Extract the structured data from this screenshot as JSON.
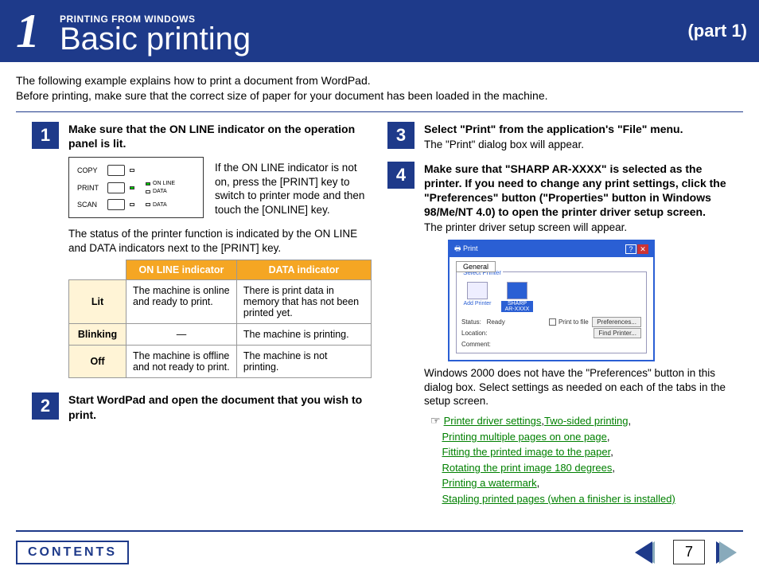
{
  "header": {
    "chapter_num": "1",
    "section": "PRINTING FROM WINDOWS",
    "title": "Basic printing",
    "part": "(part 1)"
  },
  "intro_line1": "The following example explains how to print a document from WordPad.",
  "intro_line2": "Before printing, make sure that the correct size of paper for your document has been loaded in the machine.",
  "steps": {
    "s1": {
      "num": "1",
      "title": "Make sure that the ON LINE indicator on the operation panel is lit."
    },
    "s2": {
      "num": "2",
      "title": "Start WordPad and open the document that you wish to print."
    },
    "s3": {
      "num": "3",
      "title": "Select \"Print\" from the application's \"File\" menu.",
      "text": "The \"Print\" dialog box will appear."
    },
    "s4": {
      "num": "4",
      "title": "Make sure that \"SHARP AR-XXXX\" is selected as the printer. If you need to change any print settings, click the \"Preferences\" button (\"Properties\" button in Windows 98/Me/NT 4.0) to open the printer driver setup screen.",
      "text": "The printer driver setup screen will appear."
    }
  },
  "panel": {
    "copy": "COPY",
    "print": "PRINT",
    "scan": "SCAN",
    "online": "ON LINE",
    "data": "DATA"
  },
  "panel_side_text": "If the ON LINE indicator is not on, press the [PRINT] key to switch to printer mode and then touch the [ONLINE] key.",
  "status_text": "The status of the printer function is indicated by the ON LINE and DATA indicators next to the [PRINT] key.",
  "table": {
    "h1": "ON LINE indicator",
    "h2": "DATA indicator",
    "r1": "Lit",
    "r1c1": "The machine is online and ready to print.",
    "r1c2": "There is print data in memory that has not been printed yet.",
    "r2": "Blinking",
    "r2c1": "—",
    "r2c2": "The machine is printing.",
    "r3": "Off",
    "r3c1": "The machine is offline and not ready to print.",
    "r3c2": "The machine is not printing."
  },
  "dialog": {
    "title": "Print",
    "tab": "General",
    "fieldset": "Select Printer",
    "add_printer": "Add Printer",
    "sharp": "SHARP AR-XXXX",
    "status_lbl": "Status:",
    "status_val": "Ready",
    "location_lbl": "Location:",
    "comment_lbl": "Comment:",
    "print_to_file": "Print to file",
    "preferences": "Preferences...",
    "find_printer": "Find Printer..."
  },
  "after_dialog": "Windows 2000 does not have the \"Preferences\" button in this dialog box. Select settings as needed on each of the tabs in the setup screen.",
  "hand": "☞",
  "links": {
    "l1": "Printer driver settings",
    "l2": "Two-sided printing",
    "l3": "Printing multiple pages on one page",
    "l4": "Fitting the printed image to the paper",
    "l5": "Rotating the print image 180 degrees",
    "l6": "Printing a watermark",
    "l7": "Stapling printed pages (when a finisher is installed)"
  },
  "footer": {
    "contents": "CONTENTS",
    "page": "7"
  }
}
